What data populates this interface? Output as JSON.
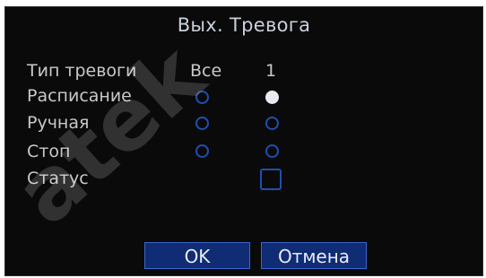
{
  "dialog": {
    "title": "Вых. Тревога"
  },
  "columns": {
    "all": "Все",
    "channel1": "1"
  },
  "rows": {
    "alarm_type": "Тип тревоги",
    "schedule": "Расписание",
    "manual": "Ручная",
    "stop": "Стоп",
    "status": "Статус"
  },
  "state": {
    "schedule_all": false,
    "schedule_ch1": true,
    "manual_all": false,
    "manual_ch1": false,
    "stop_all": false,
    "stop_ch1": false,
    "status_ch1_checked": false
  },
  "buttons": {
    "ok": "OK",
    "cancel": "Отмена"
  },
  "watermark": {
    "text": "atek"
  },
  "colors": {
    "accent": "#1f4fb0",
    "button_bg": "#0f2c74",
    "panel_bg": "#0a0a0a"
  }
}
